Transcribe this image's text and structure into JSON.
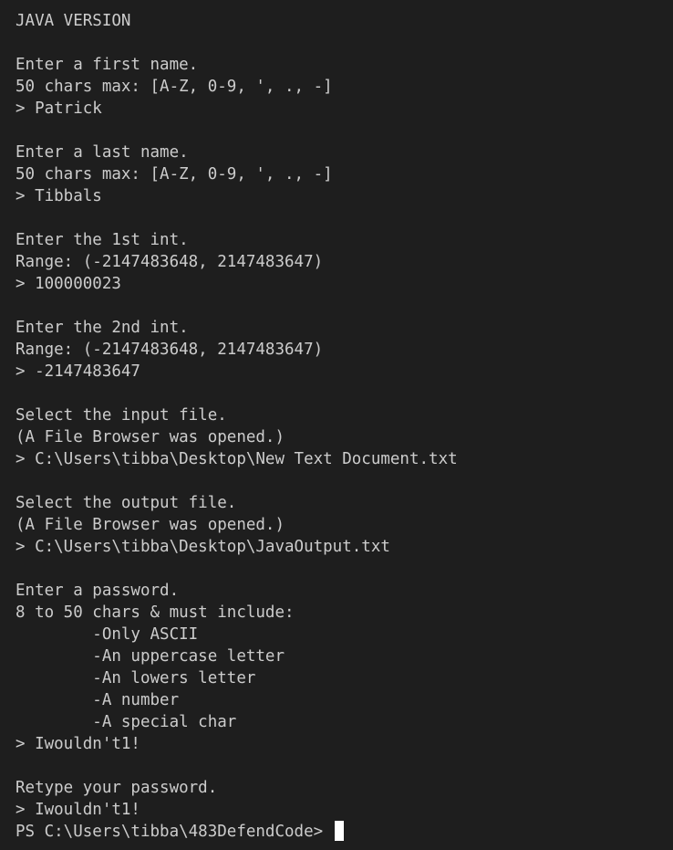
{
  "terminal": {
    "lines": [
      "JAVA VERSION",
      "",
      "Enter a first name.",
      "50 chars max: [A-Z, 0-9, ', ., -]",
      "> Patrick",
      "",
      "Enter a last name.",
      "50 chars max: [A-Z, 0-9, ', ., -]",
      "> Tibbals",
      "",
      "Enter the 1st int.",
      "Range: (-2147483648, 2147483647)",
      "> 100000023",
      "",
      "Enter the 2nd int.",
      "Range: (-2147483648, 2147483647)",
      "> -2147483647",
      "",
      "Select the input file.",
      "(A File Browser was opened.)",
      "> C:\\Users\\tibba\\Desktop\\New Text Document.txt",
      "",
      "Select the output file.",
      "(A File Browser was opened.)",
      "> C:\\Users\\tibba\\Desktop\\JavaOutput.txt",
      "",
      "Enter a password.",
      "8 to 50 chars & must include:",
      "        -Only ASCII",
      "        -An uppercase letter",
      "        -An lowers letter",
      "        -A number",
      "        -A special char",
      "> Iwouldn't1!",
      "",
      "Retype your password.",
      "> Iwouldn't1!"
    ],
    "prompt": "PS C:\\Users\\tibba\\483DefendCode> ",
    "colors": {
      "background": "#1e1e1e",
      "text": "#cccccc",
      "cursor": "#ffffff"
    }
  }
}
